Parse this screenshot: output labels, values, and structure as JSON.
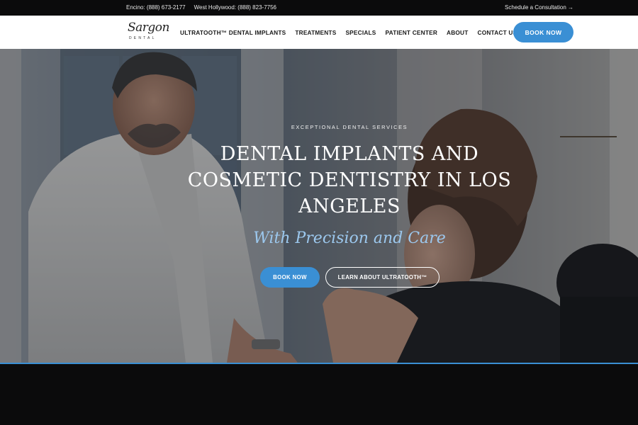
{
  "topbar": {
    "phone_encino": "Encino: (888) 673-2177",
    "phone_west_hollywood": "West Hollywood: (888) 823-7756",
    "consultation_link": "Schedule a Consultation →"
  },
  "nav": {
    "logo_script": "Sargon",
    "logo_sub": "DENTAL",
    "items": [
      "ULTRATOOTH™ DENTAL IMPLANTS",
      "TREATMENTS",
      "SPECIALS",
      "PATIENT CENTER",
      "ABOUT",
      "CONTACT US"
    ],
    "book_now": "BOOK NOW"
  },
  "hero": {
    "eyebrow": "EXCEPTIONAL DENTAL SERVICES",
    "headline": "DENTAL IMPLANTS AND COSMETIC DENTISTRY IN LOS ANGELES",
    "tagline": "With Precision and Care",
    "book_now": "BOOK NOW",
    "learn_more": "LEARN ABOUT ULTRATOOTH™"
  },
  "colors": {
    "accent": "#3a8fd4",
    "tagline": "#9cc8ee",
    "dark": "#0b0b0c"
  }
}
